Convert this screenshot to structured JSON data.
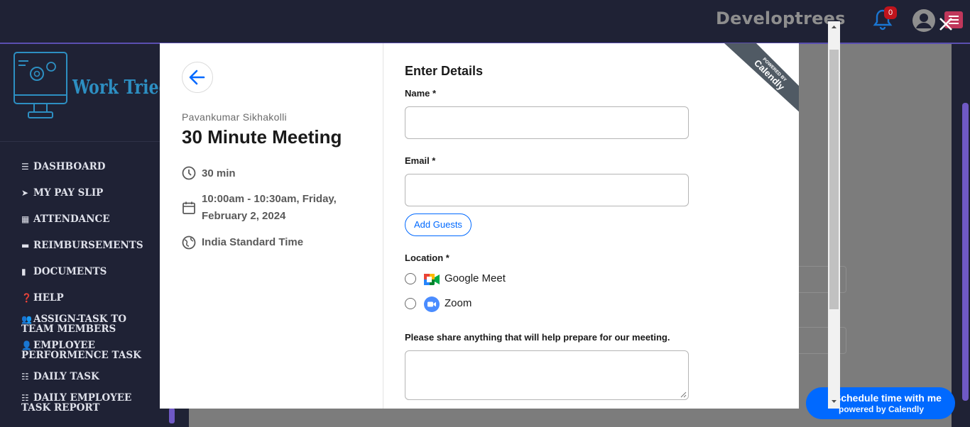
{
  "header": {
    "brand": "Developtrees",
    "notification_count": "0",
    "icons": [
      "bell-icon",
      "user-avatar-icon",
      "menu-icon",
      "close-icon"
    ]
  },
  "sidebar": {
    "logo_text": "Work Tried",
    "items": [
      {
        "label": "DASHBOARD",
        "icon": "bars-icon"
      },
      {
        "label": "MY PAY SLIP",
        "icon": "paper-plane-icon"
      },
      {
        "label": "ATTENDANCE",
        "icon": "calendar-icon"
      },
      {
        "label": "REIMBURSEMENTS",
        "icon": "credit-card-icon"
      },
      {
        "label": "DOCUMENTS",
        "icon": "file-icon"
      },
      {
        "label": "HELP",
        "icon": "question-icon"
      },
      {
        "label": "ASSIGN-TASK TO TEAM MEMBERS",
        "icon": "users-icon"
      },
      {
        "label": "EMPLOYEE PERFORMENCE TASK",
        "icon": "user-edit-icon"
      },
      {
        "label": "DAILY TASK",
        "icon": "task-list-icon"
      },
      {
        "label": "DAILY EMPLOYEE TASK REPORT",
        "icon": "task-list-icon"
      }
    ]
  },
  "modal": {
    "host_name": "Pavankumar Sikhakolli",
    "event_title": "30 Minute Meeting",
    "duration": "30 min",
    "datetime_line1": "10:00am - 10:30am, Friday,",
    "datetime_line2": "February 2, 2024",
    "timezone": "India Standard Time",
    "form_title": "Enter Details",
    "name_label": "Name *",
    "email_label": "Email *",
    "add_guests": "Add Guests",
    "location_label": "Location *",
    "locations": [
      {
        "label": "Google Meet",
        "icon": "google-meet-icon"
      },
      {
        "label": "Zoom",
        "icon": "zoom-icon"
      }
    ],
    "notes_label": "Please share anything that will help prepare for our meeting.",
    "ribbon_line1": "POWERED BY",
    "ribbon_line2": "Calendly"
  },
  "calendly_badge": {
    "line1": "Schedule time with me",
    "line2": "powered by Calendly"
  },
  "colors": {
    "topbar": "#1f2235",
    "accent_blue": "#0069ff",
    "sidebar_text": "#dfe1ea",
    "logo_blue": "#2d8fc2",
    "badge_red": "#c0141c"
  }
}
